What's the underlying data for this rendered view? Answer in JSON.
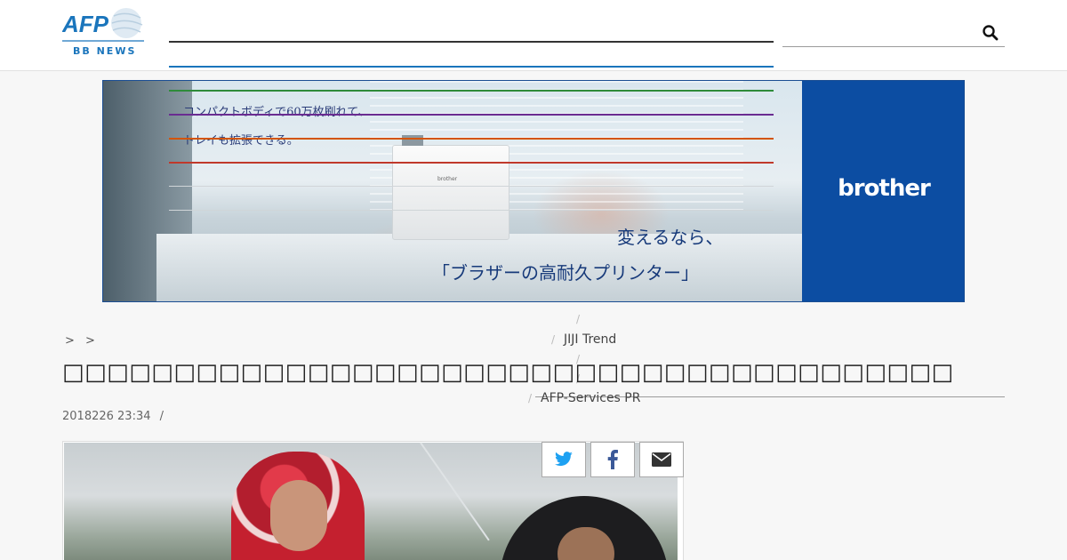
{
  "site": {
    "logo_text": "AFP",
    "logo_subtext": "BB NEWS",
    "brand_blue": "#1a75bc"
  },
  "search": {
    "placeholder": "",
    "icon": "search-icon"
  },
  "nav_colors": [
    "#333333",
    "#1a75bc",
    "#2e8b3a",
    "#6a2c91",
    "#d35400",
    "#c0392b"
  ],
  "banner": {
    "line1": "コンパクトボディで60万枚刷れて、",
    "line2": "トレイも拡張できる。",
    "copy1": "変えるなら、",
    "copy2": "「ブラザーの高耐久プリンター」",
    "printer_label": "brother",
    "brand": "brother",
    "brand_color": "#0c4da2"
  },
  "breadcrumb": {
    "sep1": ">",
    "sep2": ">"
  },
  "menu": {
    "sep": "/",
    "item1": "JIJI Trend",
    "item2": "AFP-Services PR"
  },
  "article": {
    "title": "□□□□□□□□□□□□□□□□□□□□□□□□□□□□□□□□□□□□□□□□",
    "date": "2018226 23:34",
    "date_sep": "/"
  },
  "share": {
    "twitter": "twitter-icon",
    "facebook": "facebook-icon",
    "email": "email-icon",
    "twitter_color": "#1da1f2",
    "facebook_color": "#3b5998",
    "email_color": "#333333"
  }
}
